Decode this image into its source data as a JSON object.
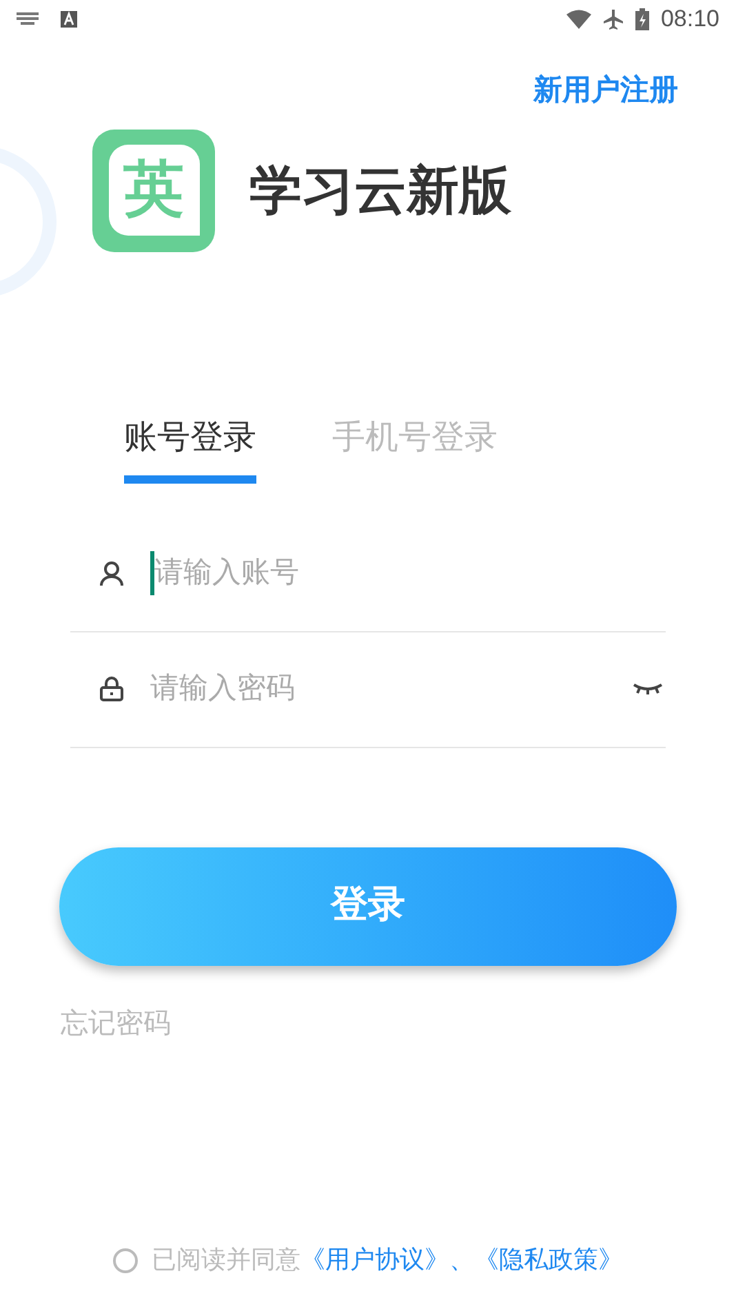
{
  "status_bar": {
    "time": "08:10"
  },
  "register_link": "新用户注册",
  "app": {
    "logo_char": "英",
    "name": "学习云新版"
  },
  "tabs": [
    {
      "label": "账号登录",
      "selected": true
    },
    {
      "label": "手机号登录",
      "selected": false
    }
  ],
  "fields": [
    {
      "kind": "account",
      "placeholder": "请输入账号",
      "focused": true
    },
    {
      "kind": "password",
      "placeholder": "请输入密码",
      "focused": false
    }
  ],
  "login_button": "登录",
  "forgot_password": "忘记密码",
  "agreement": {
    "checked": false,
    "text": "已阅读并同意",
    "links": [
      "《用户协议》",
      "《隐私政策》"
    ],
    "separator": "、"
  }
}
